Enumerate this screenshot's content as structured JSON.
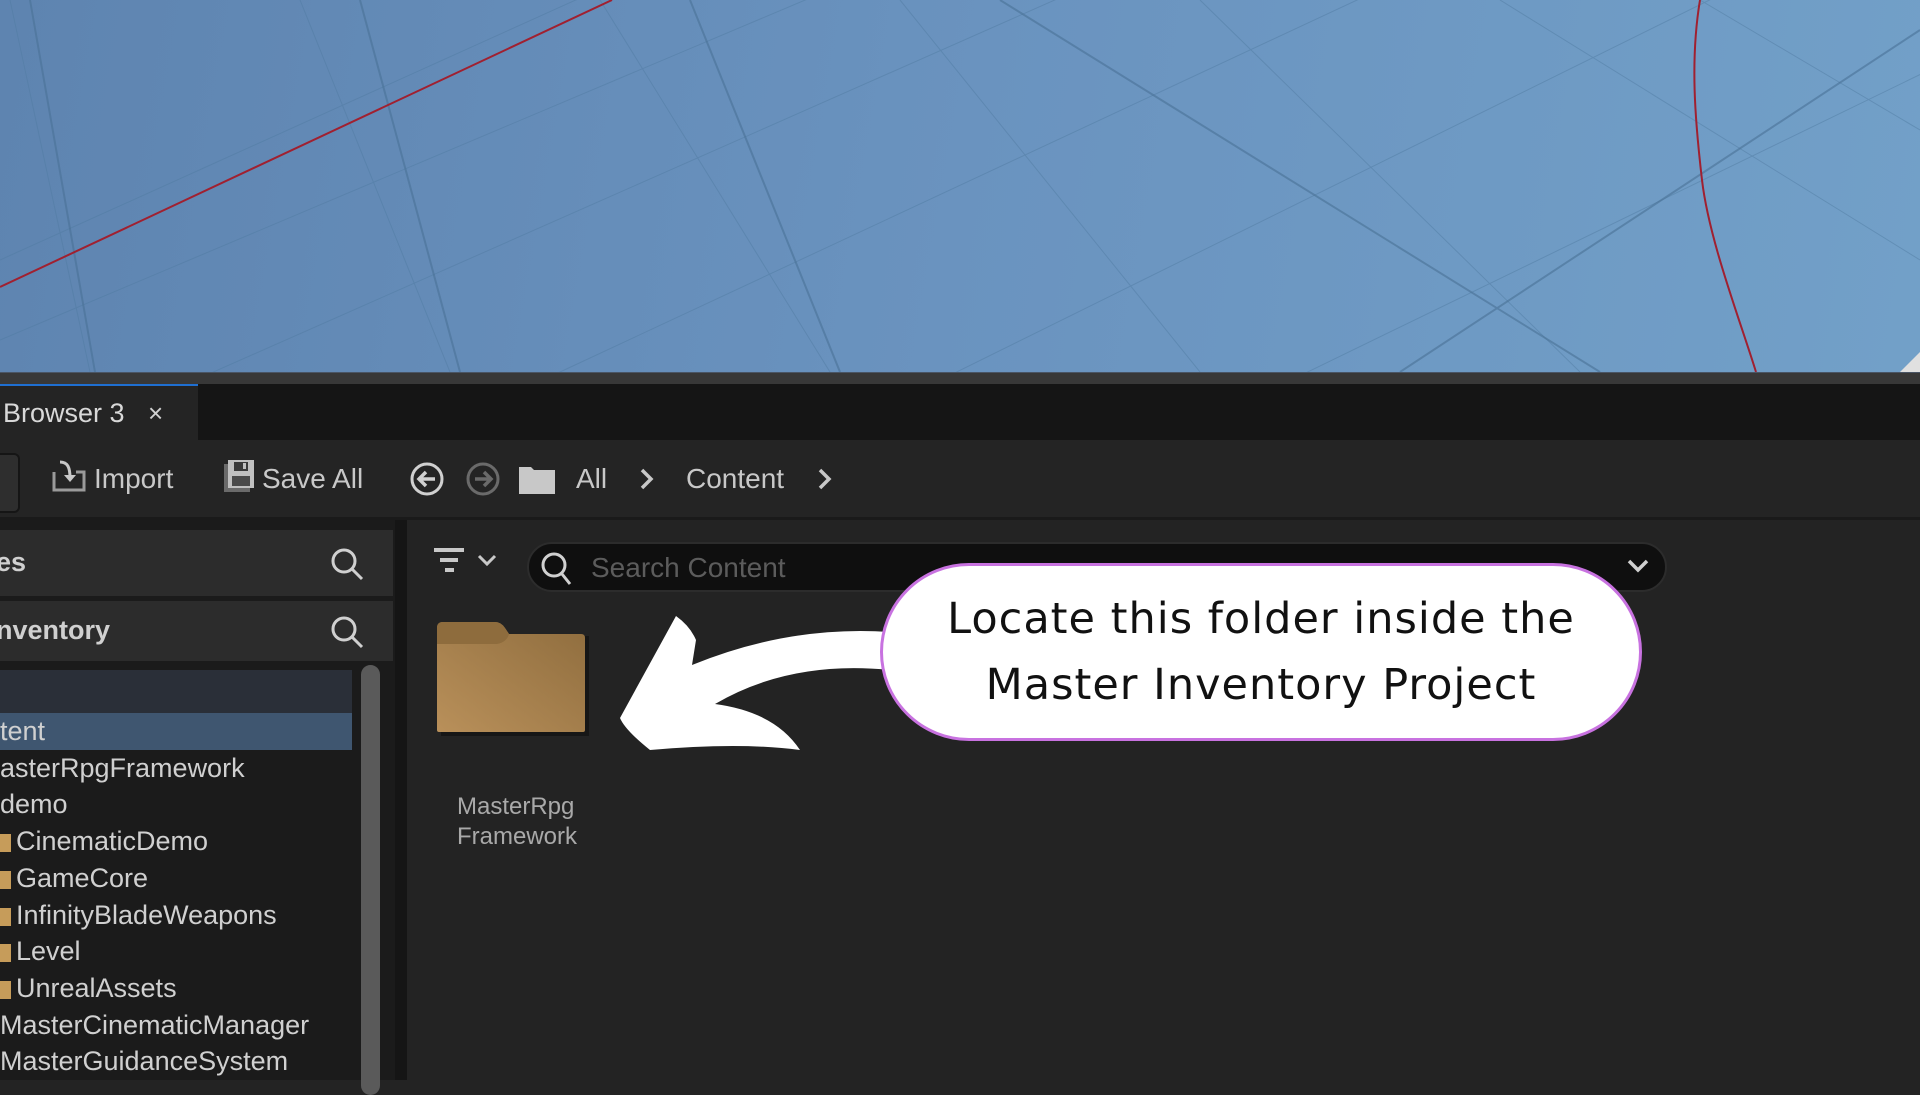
{
  "viewport": {
    "background_color": "#6a93bf",
    "axis_color": "#a02030"
  },
  "tab": {
    "label": "Browser 3",
    "close_glyph": "×",
    "accent_color": "#1f6fd1"
  },
  "toolbar": {
    "import_label": "Import",
    "save_all_label": "Save All",
    "breadcrumb": [
      "All",
      "Content"
    ]
  },
  "left_panel": {
    "favorites_label": "es",
    "project_label": "nventory",
    "tree": [
      {
        "label": "tent",
        "selected": true,
        "folder_icon": false
      },
      {
        "label": "asterRpgFramework",
        "selected": false,
        "folder_icon": false
      },
      {
        "label": "demo",
        "selected": false,
        "folder_icon": false
      },
      {
        "label": "CinematicDemo",
        "selected": false,
        "folder_icon": true
      },
      {
        "label": "GameCore",
        "selected": false,
        "folder_icon": true
      },
      {
        "label": "InfinityBladeWeapons",
        "selected": false,
        "folder_icon": true
      },
      {
        "label": "Level",
        "selected": false,
        "folder_icon": true
      },
      {
        "label": "UnrealAssets",
        "selected": false,
        "folder_icon": true
      },
      {
        "label": "MasterCinematicManager",
        "selected": false,
        "folder_icon": false
      },
      {
        "label": "MasterGuidanceSystem",
        "selected": false,
        "folder_icon": false
      }
    ]
  },
  "content": {
    "search_placeholder": "Search Content",
    "search_value": "",
    "items": [
      {
        "name_line1": "MasterRpg",
        "name_line2": "Framework",
        "type": "folder",
        "color": "#b38a50"
      }
    ]
  },
  "annotation": {
    "line1": "Locate this folder inside the",
    "line2": "Master Inventory Project",
    "border_color": "#c872e0"
  }
}
